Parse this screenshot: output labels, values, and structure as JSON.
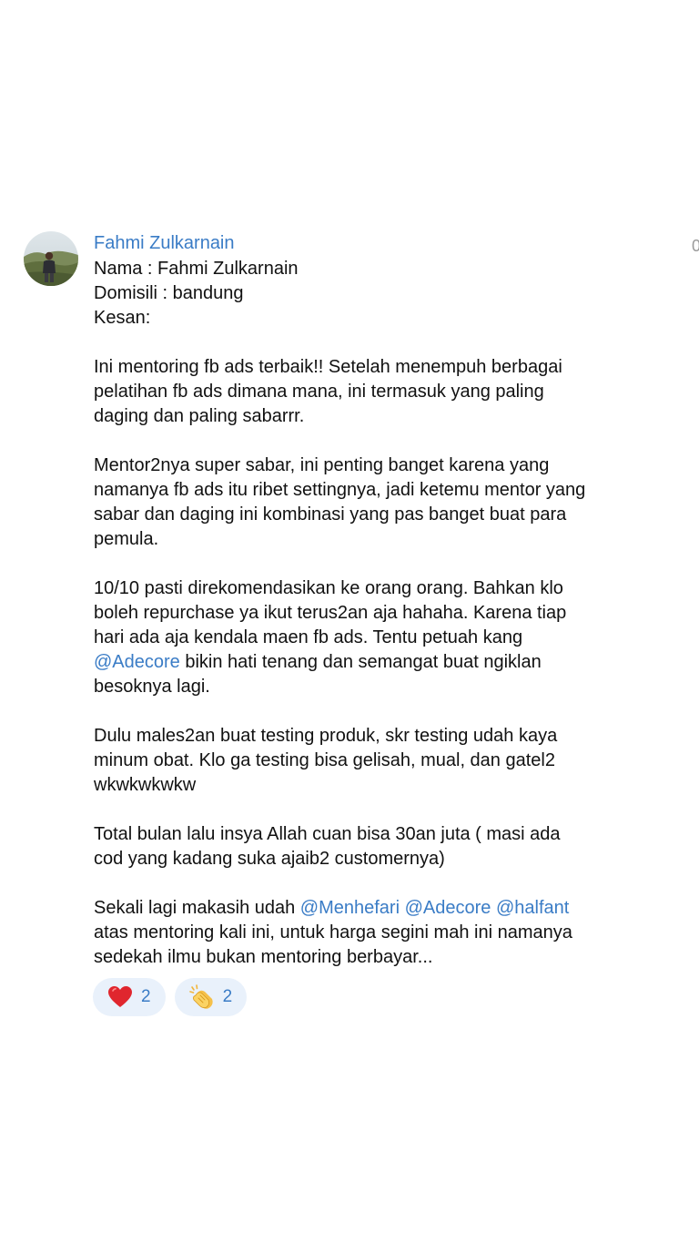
{
  "message": {
    "sender": "Fahmi Zulkarnain",
    "time_partial": "0",
    "lines": [
      [
        {
          "t": "Nama : Fahmi Zulkarnain"
        }
      ],
      [
        {
          "t": "Domisili : bandung"
        }
      ],
      [
        {
          "t": "Kesan:"
        }
      ],
      [],
      [
        {
          "t": "Ini mentoring fb ads terbaik!! Setelah menempuh berbagai"
        }
      ],
      [
        {
          "t": "pelatihan fb ads dimana mana, ini termasuk yang paling"
        }
      ],
      [
        {
          "t": "daging dan paling sabarrr."
        }
      ],
      [],
      [
        {
          "t": "Mentor2nya super sabar, ini penting banget karena yang"
        }
      ],
      [
        {
          "t": "namanya fb ads itu ribet settingnya, jadi ketemu mentor yang"
        }
      ],
      [
        {
          "t": "sabar dan daging ini kombinasi yang pas banget buat para"
        }
      ],
      [
        {
          "t": "pemula."
        }
      ],
      [],
      [
        {
          "t": "10/10 pasti direkomendasikan ke orang orang. Bahkan klo"
        }
      ],
      [
        {
          "t": "boleh repurchase ya ikut terus2an aja hahaha. Karena tiap"
        }
      ],
      [
        {
          "t": "hari ada aja kendala maen fb ads. Tentu petuah kang"
        }
      ],
      [
        {
          "t": "@Adecore",
          "m": true
        },
        {
          "t": " bikin hati tenang dan semangat buat ngiklan"
        }
      ],
      [
        {
          "t": "besoknya lagi."
        }
      ],
      [],
      [
        {
          "t": "Dulu males2an buat testing produk, skr testing udah kaya"
        }
      ],
      [
        {
          "t": "minum obat. Klo ga testing bisa gelisah, mual, dan gatel2"
        }
      ],
      [
        {
          "t": "wkwkwkwkw"
        }
      ],
      [],
      [
        {
          "t": "Total bulan lalu insya Allah cuan bisa 30an juta ( masi ada"
        }
      ],
      [
        {
          "t": "cod yang kadang suka ajaib2 customernya)"
        }
      ],
      [],
      [
        {
          "t": "Sekali lagi makasih udah "
        },
        {
          "t": "@Menhefari",
          "m": true
        },
        {
          "t": " "
        },
        {
          "t": "@Adecore",
          "m": true
        },
        {
          "t": " "
        },
        {
          "t": "@halfant",
          "m": true
        }
      ],
      [
        {
          "t": "atas mentoring kali ini, untuk harga segini mah ini namanya"
        }
      ],
      [
        {
          "t": "sedekah ilmu bukan mentoring berbayar..."
        }
      ]
    ]
  },
  "reactions": [
    {
      "icon": "heart-icon",
      "count": "2"
    },
    {
      "icon": "clapping-hands-icon",
      "count": "2"
    }
  ],
  "colors": {
    "accent": "#3a7cc6",
    "reaction_bg": "#e9f1fb",
    "text": "#111111"
  }
}
